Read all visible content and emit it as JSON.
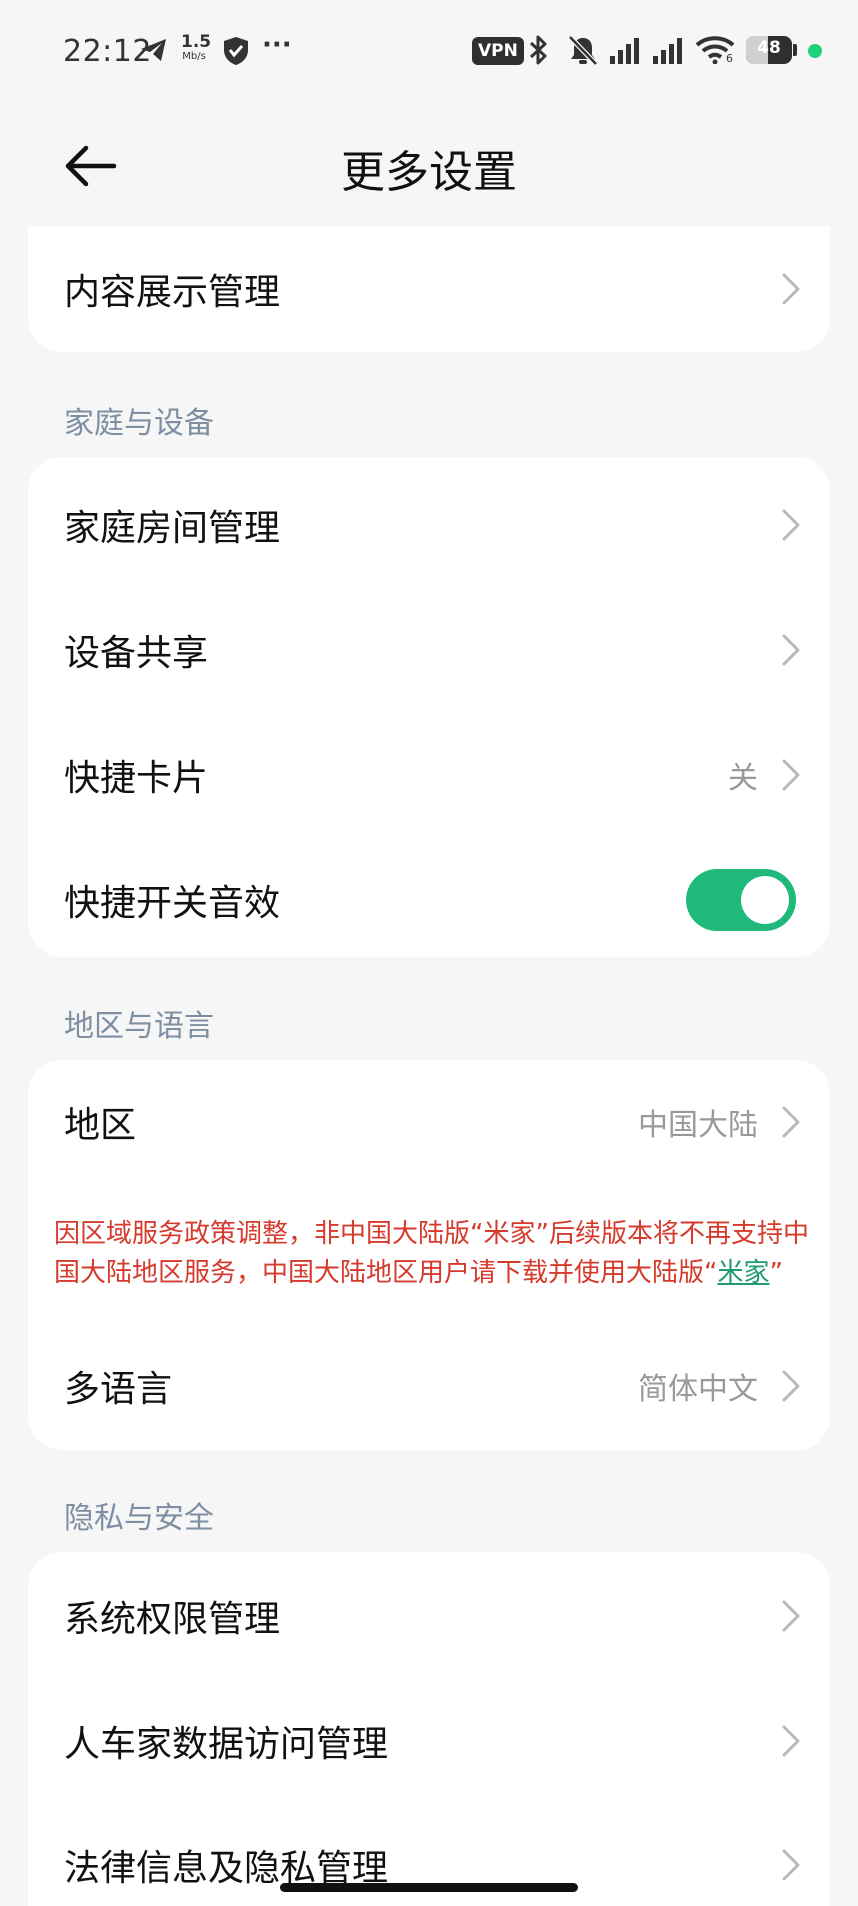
{
  "status_bar": {
    "time": "22:12",
    "net_speed_value": "1.5",
    "net_speed_unit": "Mb/s",
    "more_indicator": "···",
    "vpn_label": "VPN",
    "wifi_sub": "6",
    "battery_level": "48",
    "battery_fraction": 0.48,
    "icons": [
      "telegram-icon",
      "shield-check-icon",
      "bluetooth-icon",
      "mute-bell-icon",
      "signal-icon",
      "signal-icon",
      "wifi-icon",
      "battery-icon"
    ]
  },
  "header": {
    "title": "更多设置"
  },
  "content_card": {
    "item": "内容展示管理"
  },
  "sections": {
    "home_devices": {
      "title": "家庭与设备",
      "items": [
        {
          "label": "家庭房间管理"
        },
        {
          "label": "设备共享"
        },
        {
          "label": "快捷卡片",
          "value": "关"
        },
        {
          "label": "快捷开关音效",
          "toggle_on": true
        }
      ]
    },
    "region_language": {
      "title": "地区与语言",
      "region_label": "地区",
      "region_value": "中国大陆",
      "notice_text": "因区域服务政策调整，非中国大陆版“米家”后续版本将不再支持中国大陆地区服务，中国大陆地区用户请下载并使用大陆版“",
      "notice_link": "米家",
      "notice_end": "”",
      "language_label": "多语言",
      "language_value": "简体中文"
    },
    "privacy_security": {
      "title": "隐私与安全",
      "items": [
        {
          "label": "系统权限管理"
        },
        {
          "label": "人车家数据访问管理"
        },
        {
          "label": "法律信息及隐私管理"
        }
      ]
    }
  },
  "colors": {
    "accent_green": "#1fba7b",
    "notice_red": "#d63a2c",
    "link_green": "#1e9b74",
    "section_title": "#7e8ea3",
    "background": "#f6f6f6"
  }
}
